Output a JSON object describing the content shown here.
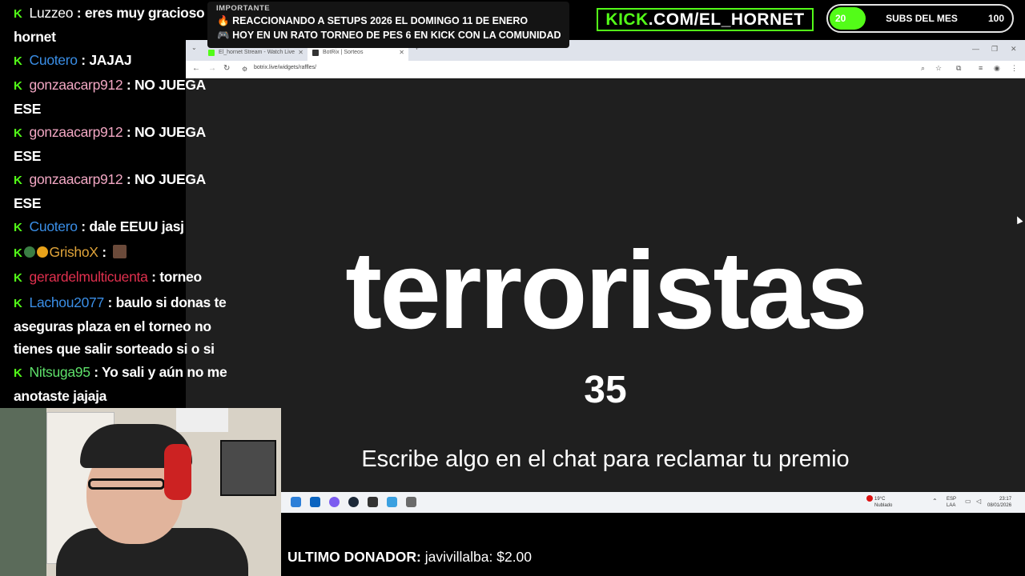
{
  "notice": {
    "label": "IMPORTANTE",
    "line1": "REACCIONANDO A SETUPS 2026 EL DOMINGO 11 DE ENERO",
    "line2": "HOY EN UN RATO TORNEO DE PES 6 EN KICK CON LA COMUNIDAD",
    "icon1": "fire-icon",
    "icon2": "gamepad-icon"
  },
  "kick_url": {
    "brand": "KICK",
    "rest": ".COM/EL_HORNET"
  },
  "subs_goal": {
    "current": "20",
    "label": "SUBS DEL MES",
    "target": "100",
    "progress": 0.2
  },
  "browser": {
    "tabs": [
      {
        "title": "El_hornet Stream - Watch Live"
      },
      {
        "title": "BotRix | Sorteos"
      }
    ],
    "url": "botrix.live/widgets/raffles/"
  },
  "raffle": {
    "word": "terroristas",
    "count": "35",
    "hint": "Escribe algo en el chat para reclamar tu premio"
  },
  "taskbar": {
    "weather_temp": "19°C",
    "weather_desc": "Nublado",
    "lang1": "ESP",
    "lang2": "LAA",
    "time": "23:17",
    "date": "08/01/2026"
  },
  "chat": [
    {
      "user": "Luzzeo",
      "color": "#ffffff",
      "sep": " : ",
      "text": "eres muy gracioso hornet"
    },
    {
      "user": "Cuotero",
      "color": "#3a8ee6",
      "sep": " : ",
      "text": "JAJAJ"
    },
    {
      "user": "gonzaacarp912",
      "color": "#f2a7c3",
      "sep": " : ",
      "text": "NO JUEGA ESE"
    },
    {
      "user": "gonzaacarp912",
      "color": "#f2a7c3",
      "sep": " : ",
      "text": "NO JUEGA ESE"
    },
    {
      "user": "gonzaacarp912",
      "color": "#f2a7c3",
      "sep": " : ",
      "text": "NO JUEGA ESE"
    },
    {
      "user": "Cuotero",
      "color": "#3a8ee6",
      "sep": " : ",
      "text": "dale EEUU jasj"
    },
    {
      "user": "GrishoX",
      "color": "#e0a43a",
      "sep": " : ",
      "text": ""
    },
    {
      "user": "gerardelmulticuenta",
      "color": "#e0304e",
      "sep": " : ",
      "text": "torneo"
    },
    {
      "user": "Lachou2077",
      "color": "#3a8ee6",
      "sep": " : ",
      "text": "baulo si donas te aseguras plaza en el torneo no tienes que salir sorteado si o si"
    },
    {
      "user": "Nitsuga95",
      "color": "#5ee06a",
      "sep": " : ",
      "text": "Yo sali y aún no me anotaste jajaja"
    }
  ],
  "donor": {
    "label": "ULTIMO DONADOR:",
    "value": "javivillalba: $2.00"
  },
  "colors": {
    "kick_green": "#53fc18",
    "page_bg": "#1f1f1f"
  }
}
